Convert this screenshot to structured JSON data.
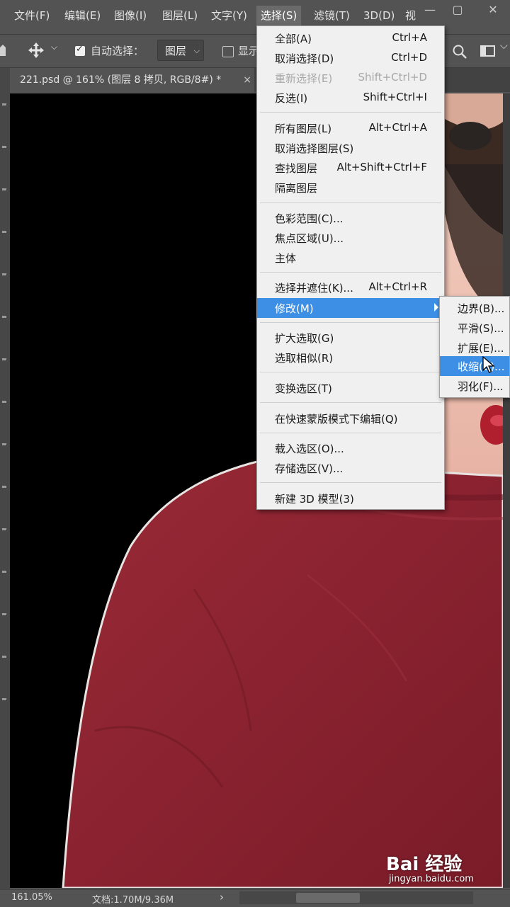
{
  "menubar": {
    "items": [
      "文件(F)",
      "编辑(E)",
      "图像(I)",
      "图层(L)",
      "文字(Y)",
      "选择(S)",
      "滤镜(T)",
      "3D(D)",
      "视"
    ],
    "active": "选择(S)",
    "window_controls": [
      "—",
      "▢",
      "✕"
    ]
  },
  "options": {
    "auto_select_label": "自动选择：",
    "auto_select_checked": true,
    "layer_dropdown": "图层",
    "show_label": "显示"
  },
  "document": {
    "tab_title": "221.psd @ 161% (图层 8 拷贝, RGB/8#) *",
    "close": "×"
  },
  "select_menu": {
    "items": [
      {
        "label": "全部(A)",
        "shortcut": "Ctrl+A"
      },
      {
        "label": "取消选择(D)",
        "shortcut": "Ctrl+D"
      },
      {
        "label": "重新选择(E)",
        "shortcut": "Shift+Ctrl+D",
        "disabled": true
      },
      {
        "label": "反选(I)",
        "shortcut": "Shift+Ctrl+I"
      },
      {
        "label": "所有图层(L)",
        "shortcut": "Alt+Ctrl+A"
      },
      {
        "label": "取消选择图层(S)",
        "shortcut": ""
      },
      {
        "label": "查找图层",
        "shortcut": "Alt+Shift+Ctrl+F"
      },
      {
        "label": "隔离图层",
        "shortcut": ""
      },
      {
        "label": "色彩范围(C)...",
        "shortcut": ""
      },
      {
        "label": "焦点区域(U)...",
        "shortcut": ""
      },
      {
        "label": "主体",
        "shortcut": ""
      },
      {
        "label": "选择并遮住(K)...",
        "shortcut": "Alt+Ctrl+R"
      },
      {
        "label": "修改(M)",
        "shortcut": "",
        "highlighted": true,
        "submenu": true
      },
      {
        "label": "扩大选取(G)",
        "shortcut": ""
      },
      {
        "label": "选取相似(R)",
        "shortcut": ""
      },
      {
        "label": "变换选区(T)",
        "shortcut": ""
      },
      {
        "label": "在快速蒙版模式下编辑(Q)",
        "shortcut": ""
      },
      {
        "label": "载入选区(O)...",
        "shortcut": ""
      },
      {
        "label": "存储选区(V)...",
        "shortcut": ""
      },
      {
        "label": "新建 3D 模型(3)",
        "shortcut": ""
      }
    ]
  },
  "modify_submenu": {
    "items": [
      {
        "label": "边界(B)..."
      },
      {
        "label": "平滑(S)..."
      },
      {
        "label": "扩展(E)..."
      },
      {
        "label": "收缩(C)...",
        "highlighted": true
      },
      {
        "label": "羽化(F)..."
      }
    ]
  },
  "statusbar": {
    "zoom": "161.05%",
    "doc_info": "文档:1.70M/9.36M",
    "arrow": "›"
  },
  "watermark": {
    "logo": "Bai 经验",
    "url": "jingyan.baidu.com"
  },
  "colors": {
    "highlight": "#3d8fe6",
    "sweater": "#8e2430",
    "canvas": "#000000"
  }
}
